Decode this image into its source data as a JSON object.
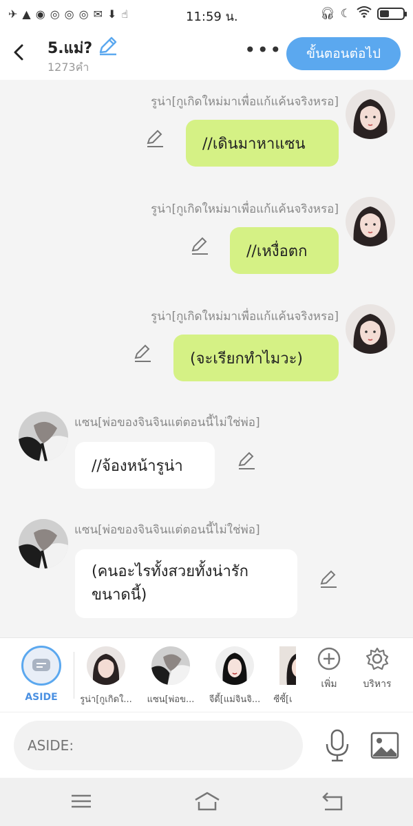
{
  "status_bar": {
    "time": "11:59 น.",
    "battery_percent": 40
  },
  "header": {
    "title": "5.แม่?",
    "word_count": "1273คำ",
    "next_button": "ขั้นตอนต่อไป"
  },
  "messages": [
    {
      "speaker": "รูน่า[กูเกิดใหม่มาเพื่อแก้แค้นจริงหรอ]",
      "text": "//เดินมาหาแซน"
    },
    {
      "speaker": "รูน่า[กูเกิดใหม่มาเพื่อแก้แค้นจริงหรอ]",
      "text": "//เหงื่อตก"
    },
    {
      "speaker": "รูน่า[กูเกิดใหม่มาเพื่อแก้แค้นจริงหรอ]",
      "text": "(จะเรียกทำไมวะ)"
    },
    {
      "speaker": "แซน[พ่อของจินจินแต่ตอนนี้ไม่ใช่พ่อ]",
      "text": "//จ้องหน้ารูน่า"
    },
    {
      "speaker": "แซน[พ่อของจินจินแต่ตอนนี้ไม่ใช่พ่อ]",
      "text_line1": "(คนอะไรทั้งสวยทั้งน่ารัก",
      "text_line2": "ขนาดนี้)"
    }
  ],
  "character_bar": {
    "aside_label": "ASIDE",
    "characters": [
      "รูน่า[กูเกิดใ...",
      "แซน[พ่อข...",
      "จีดี้[แม่จินจิ...",
      "ซีซี้[เ"
    ],
    "add_label": "เพิ่ม",
    "manage_label": "บริหาร"
  },
  "input": {
    "placeholder": "ASIDE:"
  },
  "colors": {
    "accent": "#5ba8ef",
    "my_bubble": "#d5f185",
    "other_bubble": "#ffffff"
  }
}
